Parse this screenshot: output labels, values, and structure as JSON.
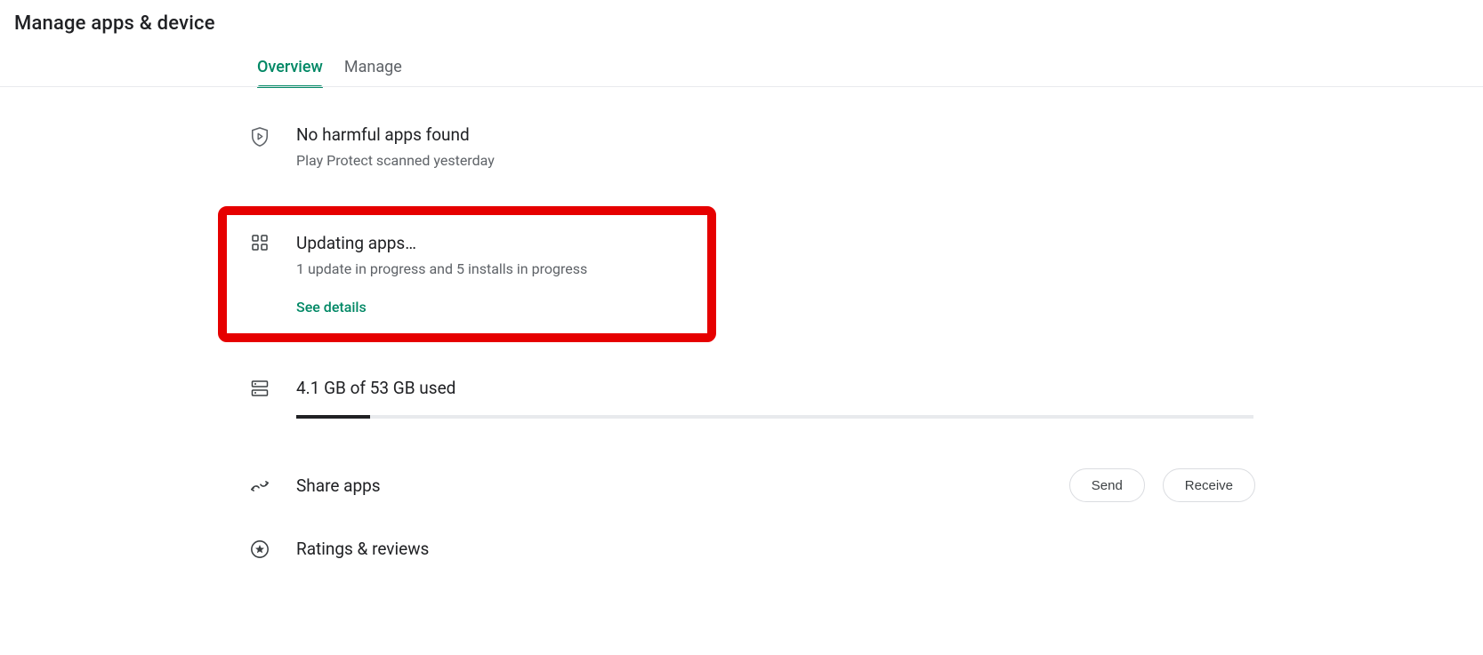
{
  "header": {
    "title": "Manage apps & device"
  },
  "tabs": {
    "overview": "Overview",
    "manage": "Manage"
  },
  "protect": {
    "title": "No harmful apps found",
    "subtitle": "Play Protect scanned yesterday"
  },
  "updates": {
    "title": "Updating apps…",
    "subtitle": "1 update in progress and 5 installs in progress",
    "details_link": "See details"
  },
  "storage": {
    "title": "4.1 GB of 53 GB used",
    "used_gb": 4.1,
    "total_gb": 53,
    "percent": 7.7
  },
  "share": {
    "title": "Share apps",
    "send_label": "Send",
    "receive_label": "Receive"
  },
  "ratings": {
    "title": "Ratings & reviews"
  },
  "colors": {
    "accent": "#018865",
    "highlight_border": "#e60000"
  }
}
